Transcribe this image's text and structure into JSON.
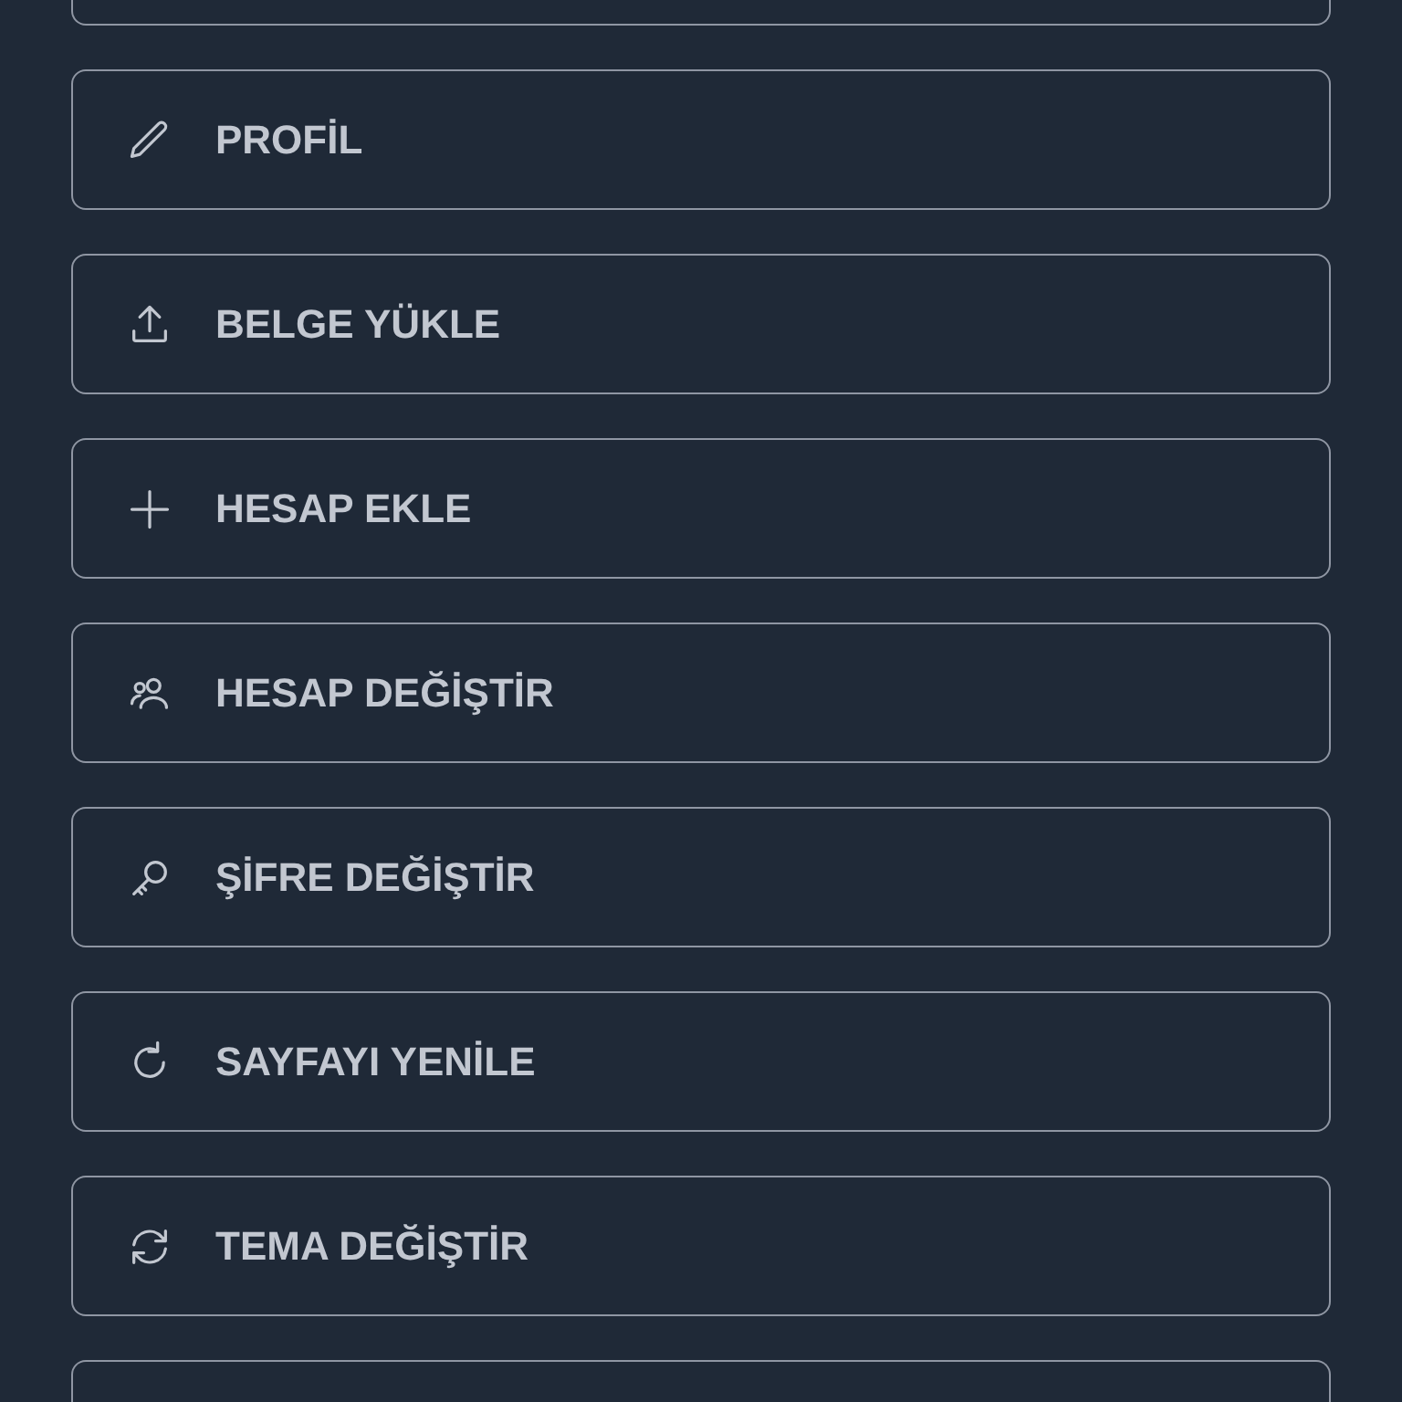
{
  "menu": [
    {
      "kind": "cut"
    },
    {
      "kind": "item",
      "label": "PROFİL"
    },
    {
      "kind": "item",
      "label": "BELGE YÜKLE"
    },
    {
      "kind": "item",
      "label": "HESAP EKLE"
    },
    {
      "kind": "item",
      "label": "HESAP DEĞİŞTİR"
    },
    {
      "kind": "item",
      "label": "ŞİFRE DEĞİŞTİR"
    },
    {
      "kind": "item",
      "label": "SAYFAYI YENİLE"
    },
    {
      "kind": "item",
      "label": "TEMA DEĞİŞTİR"
    },
    {
      "kind": "cut"
    }
  ]
}
